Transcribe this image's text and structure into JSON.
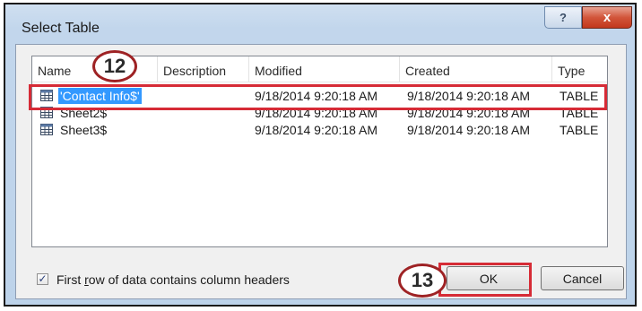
{
  "dialog": {
    "title": "Select Table",
    "help_label": "?",
    "close_label": "x"
  },
  "columns": [
    "Name",
    "Description",
    "Modified",
    "Created",
    "Type"
  ],
  "rows": [
    {
      "name": "'Contact Info$'",
      "description": "",
      "modified": "9/18/2014 9:20:18 AM",
      "created": "9/18/2014 9:20:18 AM",
      "type": "TABLE",
      "selected": true
    },
    {
      "name": "Sheet2$",
      "description": "",
      "modified": "9/18/2014 9:20:18 AM",
      "created": "9/18/2014 9:20:18 AM",
      "type": "TABLE",
      "selected": false
    },
    {
      "name": "Sheet3$",
      "description": "",
      "modified": "9/18/2014 9:20:18 AM",
      "created": "9/18/2014 9:20:18 AM",
      "type": "TABLE",
      "selected": false
    }
  ],
  "footer": {
    "checkbox_checked": true,
    "checkbox_label_pre": "First ",
    "checkbox_label_access": "r",
    "checkbox_label_post": "ow of data contains column headers",
    "ok_label": "OK",
    "cancel_label": "Cancel"
  },
  "annotations": {
    "step_12": "12",
    "step_13": "13"
  },
  "colors": {
    "selection": "#3399ff",
    "annotation_red": "#d62b36",
    "close_button": "#c2371d"
  }
}
